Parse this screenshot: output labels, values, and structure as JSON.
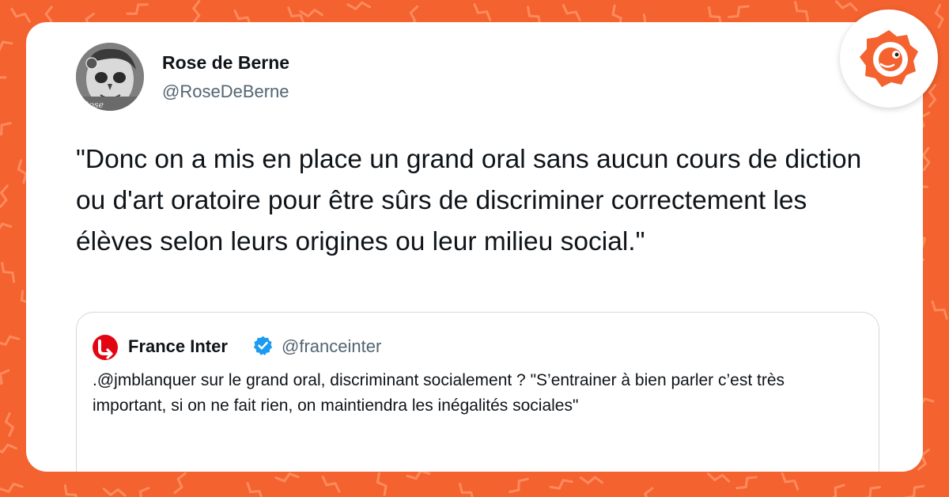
{
  "colors": {
    "background": "#f4622f",
    "pattern_stroke": "#ff9a6e",
    "verified": "#1d9bf0",
    "brand": "#f4622f",
    "france_inter_red": "#e20613"
  },
  "tweet": {
    "author_name": "Rose de Berne",
    "author_handle": "@RoseDeBerne",
    "avatar_signature": "Rose",
    "text": "\"Donc on a mis en place un grand oral sans aucun cours de diction ou d'art oratoire pour être sûrs de discriminer correctement les élèves selon leurs origines ou leur milieu social.\""
  },
  "quoted_tweet": {
    "author_name": "France Inter",
    "author_handle": "@franceinter",
    "verified": true,
    "logo_icon": "france-inter-logo",
    "text": ".@jmblanquer sur le grand oral, discriminant socialement ? \"S’entrainer à bien parler c’est très important, si on ne fait rien, on maintiendra les inégalités sociales\""
  },
  "brand_badge": {
    "icon": "brand-mascot-icon"
  }
}
